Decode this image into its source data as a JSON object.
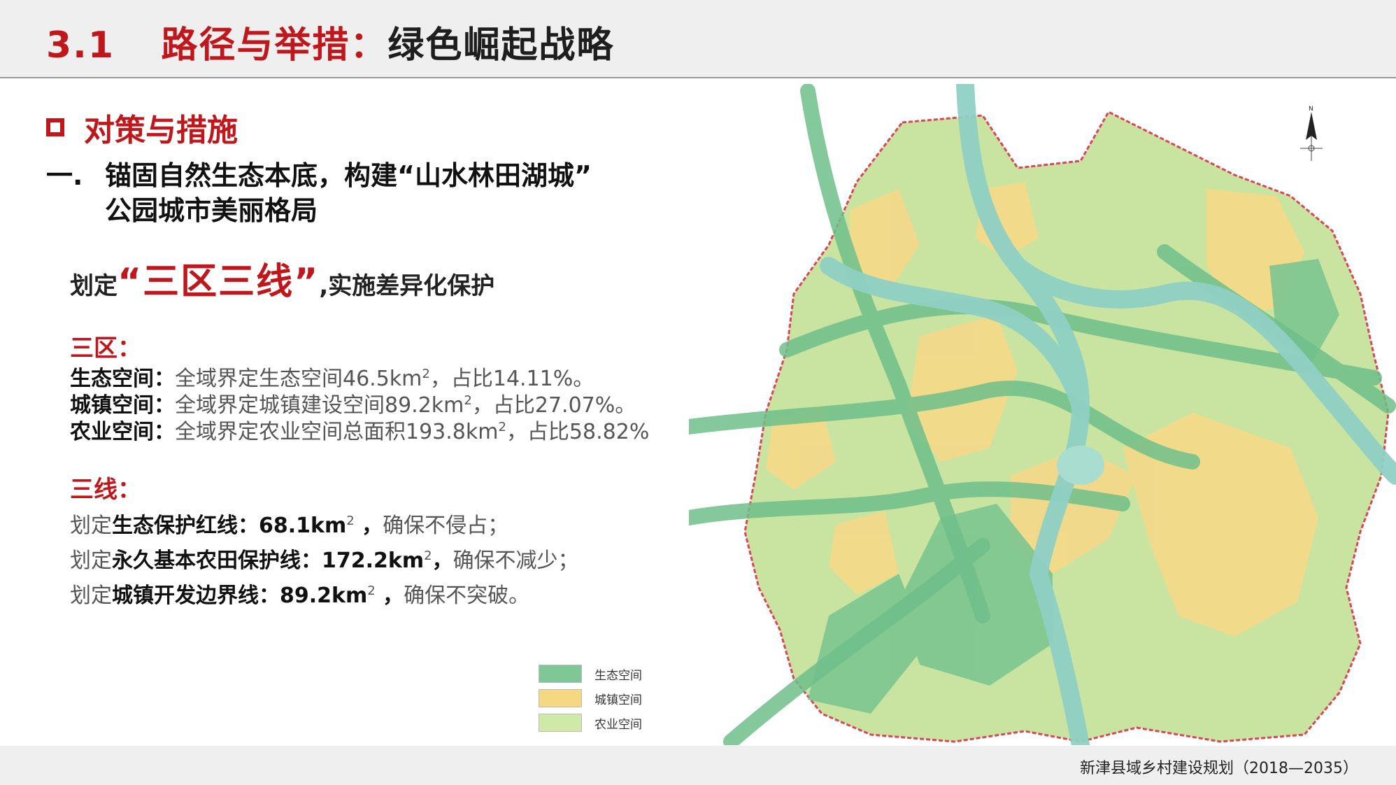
{
  "header": {
    "number": "3.1",
    "title_red": "路径与举措：",
    "title_dark": "绿色崛起战略"
  },
  "section": {
    "title": "对策与措施"
  },
  "point": {
    "index": "一.",
    "line1": "锚固自然生态本底，构建“山水林田湖城”",
    "line2": "公园城市美丽格局"
  },
  "delimit": {
    "prefix": "划定",
    "highlight": "“三区三线”",
    "suffix": ",实施差异化保护"
  },
  "three_zones": {
    "heading": "三区：",
    "items": [
      {
        "label": "生态空间：",
        "text": "全域界定生态空间46.5km",
        "sup": "2",
        "tail": "，占比14.11%。"
      },
      {
        "label": "城镇空间：",
        "text": "全域界定城镇建设空间89.2km",
        "sup": "2",
        "tail": "，占比27.07%。"
      },
      {
        "label": "农业空间：",
        "text": "全域界定农业空间总面积193.8km",
        "sup": "2",
        "tail": "，占比58.82%"
      }
    ]
  },
  "three_lines": {
    "heading": "三线：",
    "items": [
      {
        "prefix": "划定",
        "label": "生态保护红线：68.1km",
        "sup": "2",
        "tail": " ，",
        "tail2": "确保不侵占；"
      },
      {
        "prefix": "划定",
        "label": "永久基本农田保护线：172.2km",
        "sup": "2",
        "tail": "，",
        "tail2": "确保不减少；"
      },
      {
        "prefix": "划定",
        "label": "城镇开发边界线：89.2km",
        "sup": "2",
        "tail": " ，",
        "tail2": "确保不突破。"
      }
    ]
  },
  "legend": [
    {
      "label": "生态空间",
      "color": "#7dc894"
    },
    {
      "label": "城镇空间",
      "color": "#f6d782"
    },
    {
      "label": "农业空间",
      "color": "#cfe9a6"
    }
  ],
  "map": {
    "north_label": "N",
    "colors": {
      "agri": "#c9e4a0",
      "town": "#f4d98a",
      "eco": "#7cc490",
      "river": "#8fd0c4",
      "boundary": "#d8465a"
    }
  },
  "footer": {
    "text": "新津县域乡村建设规划（2018—2035）"
  }
}
